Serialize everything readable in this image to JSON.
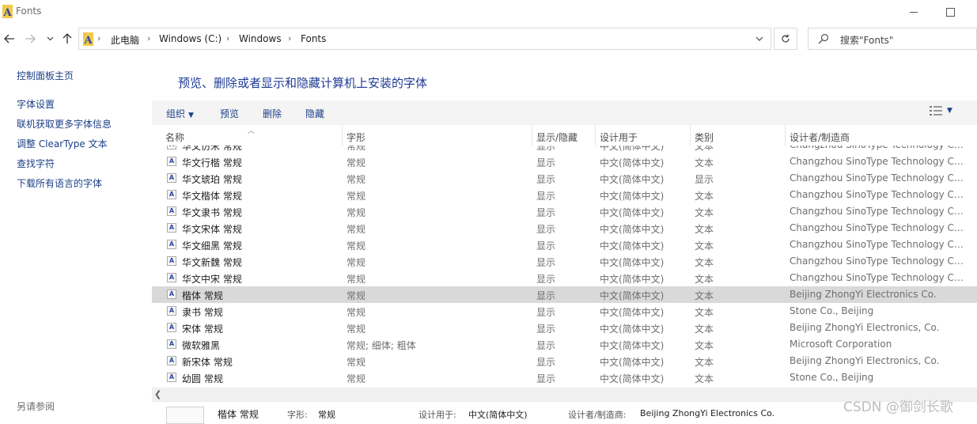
{
  "window": {
    "title": "Fonts"
  },
  "address": {
    "crumbs": [
      "此电脑",
      "Windows (C:)",
      "Windows",
      "Fonts"
    ],
    "search_placeholder": "搜索\"Fonts\""
  },
  "left_pane": {
    "home": "控制面板主页",
    "links": [
      "字体设置",
      "联机获取更多字体信息",
      "调整 ClearType 文本",
      "查找字符",
      "下载所有语言的字体"
    ],
    "see_also": "另请参阅"
  },
  "heading": "预览、删除或者显示和隐藏计算机上安装的字体",
  "toolbar": {
    "organize": "组织",
    "preview": "预览",
    "delete": "删除",
    "hide": "隐藏"
  },
  "columns": {
    "name": "名称",
    "style": "字形",
    "visibility": "显示/隐藏",
    "designed_for": "设计用于",
    "category": "类别",
    "designer": "设计者/制造商"
  },
  "rows": [
    {
      "name": "华文仿宋 常规",
      "style": "常规",
      "vis": "显示",
      "design": "中文(简体中文)",
      "cat": "文本",
      "maker": "Changzhou SinoType Technology Co.…",
      "selected": false
    },
    {
      "name": "华文行楷 常规",
      "style": "常规",
      "vis": "显示",
      "design": "中文(简体中文)",
      "cat": "文本",
      "maker": "Changzhou SinoType Technology Co.…",
      "selected": false
    },
    {
      "name": "华文琥珀 常规",
      "style": "常规",
      "vis": "显示",
      "design": "中文(简体中文)",
      "cat": "显示",
      "maker": "Changzhou SinoType Technology Co.…",
      "selected": false
    },
    {
      "name": "华文楷体 常规",
      "style": "常规",
      "vis": "显示",
      "design": "中文(简体中文)",
      "cat": "文本",
      "maker": "Changzhou SinoType Technology Co.…",
      "selected": false
    },
    {
      "name": "华文隶书 常规",
      "style": "常规",
      "vis": "显示",
      "design": "中文(简体中文)",
      "cat": "文本",
      "maker": "Changzhou SinoType Technology Co.…",
      "selected": false
    },
    {
      "name": "华文宋体 常规",
      "style": "常规",
      "vis": "显示",
      "design": "中文(简体中文)",
      "cat": "文本",
      "maker": "Changzhou SinoType Technology Co.…",
      "selected": false
    },
    {
      "name": "华文细黑 常规",
      "style": "常规",
      "vis": "显示",
      "design": "中文(简体中文)",
      "cat": "文本",
      "maker": "Changzhou SinoType Technology Co.…",
      "selected": false
    },
    {
      "name": "华文新魏 常规",
      "style": "常规",
      "vis": "显示",
      "design": "中文(简体中文)",
      "cat": "文本",
      "maker": "Changzhou SinoType Technology Co.…",
      "selected": false
    },
    {
      "name": "华文中宋 常规",
      "style": "常规",
      "vis": "显示",
      "design": "中文(简体中文)",
      "cat": "文本",
      "maker": "Changzhou SinoType Technology Co.…",
      "selected": false
    },
    {
      "name": "楷体 常规",
      "style": "常规",
      "vis": "显示",
      "design": "中文(简体中文)",
      "cat": "文本",
      "maker": "Beijing ZhongYi Electronics Co.",
      "selected": true
    },
    {
      "name": "隶书 常规",
      "style": "常规",
      "vis": "显示",
      "design": "中文(简体中文)",
      "cat": "文本",
      "maker": "Stone Co., Beijing",
      "selected": false
    },
    {
      "name": "宋体 常规",
      "style": "常规",
      "vis": "显示",
      "design": "中文(简体中文)",
      "cat": "文本",
      "maker": "Beijing ZhongYi Electronics, Co.",
      "selected": false
    },
    {
      "name": "微软雅黑",
      "style": "常规; 细体; 粗体",
      "vis": "显示",
      "design": "中文(简体中文)",
      "cat": "文本",
      "maker": "Microsoft Corporation",
      "selected": false
    },
    {
      "name": "新宋体 常规",
      "style": "常规",
      "vis": "显示",
      "design": "中文(简体中文)",
      "cat": "文本",
      "maker": "Beijing ZhongYi Electronics, Co.",
      "selected": false
    },
    {
      "name": "幼圆 常规",
      "style": "常规",
      "vis": "显示",
      "design": "中文(简体中文)",
      "cat": "文本",
      "maker": "Stone Co., Beijing",
      "selected": false
    }
  ],
  "details": {
    "name": "楷体 常规",
    "style_label": "字形:",
    "style_value": "常规",
    "design_label": "设计用于:",
    "design_value": "中文(简体中文)",
    "maker_label": "设计者/制造商:",
    "maker_value": "Beijing ZhongYi Electronics Co."
  },
  "watermark": "CSDN @御剑长歌",
  "icons": [
    "fonts-folder-icon",
    "minimize-icon",
    "maximize-icon",
    "back-arrow-icon",
    "forward-arrow-icon",
    "recent-locations-icon",
    "up-arrow-icon",
    "chevron-right-icon",
    "dropdown-icon",
    "refresh-icon",
    "search-icon",
    "view-options-icon",
    "font-file-icon",
    "scroll-left-icon"
  ],
  "colors": {
    "link": "#1c3f87",
    "heading": "#1f3a93",
    "selected_row": "#d9d9d9",
    "toolbar_bg": "#f4f4f4"
  }
}
